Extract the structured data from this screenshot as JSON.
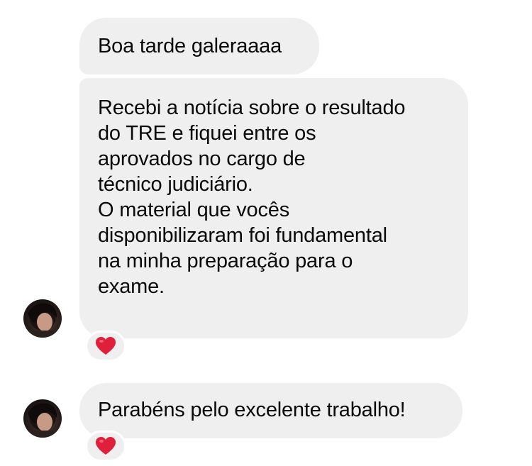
{
  "messages": [
    {
      "text": "Boa tarde galeraaaa"
    },
    {
      "lines": [
        "Recebi a notícia sobre o resultado",
        "do TRE e fiquei entre os",
        "aprovados no cargo de",
        "técnico judiciário.",
        "O material que vocês",
        "disponibilizaram foi fundamental",
        "na minha preparação para o",
        "exame."
      ],
      "reaction": "heart-icon"
    },
    {
      "text": "Parabéns pelo excelente trabalho!",
      "reaction": "heart-icon"
    }
  ],
  "colors": {
    "bubble_bg": "#efefef",
    "heart": "#e0203a",
    "text": "#0a0a0a"
  }
}
